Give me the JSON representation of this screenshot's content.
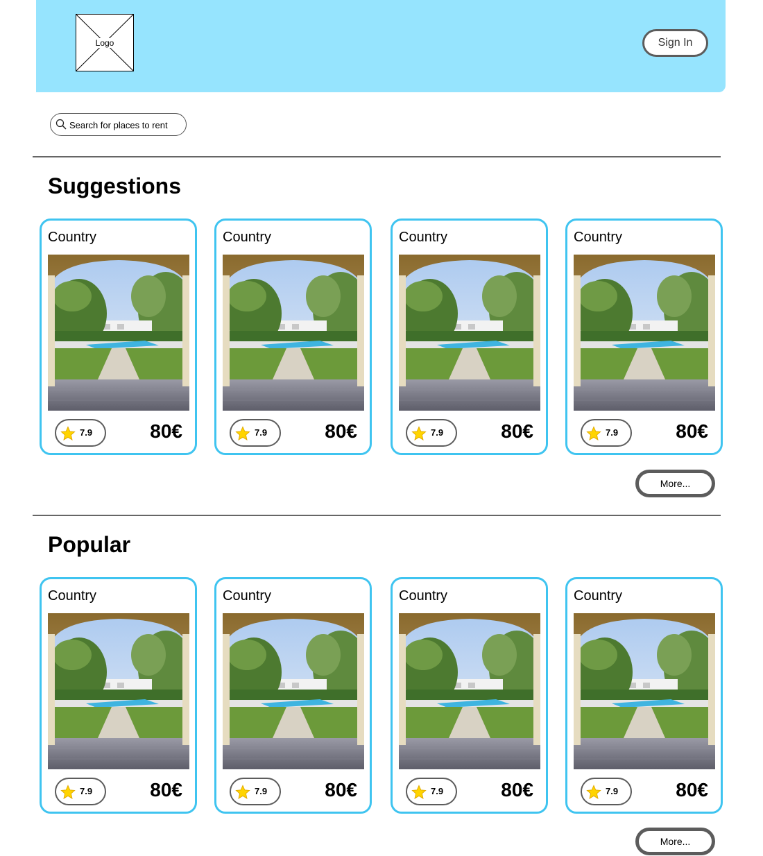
{
  "header": {
    "logo_label": "Logo",
    "signin_label": "Sign In",
    "background_color": "#96e4fe"
  },
  "search": {
    "placeholder": "Search for places to rent",
    "value": "",
    "icon": "search-icon"
  },
  "sections": [
    {
      "title": "Suggestions",
      "more_label": "More...",
      "cards": [
        {
          "country": "Country",
          "rating": "7.9",
          "price": "80€"
        },
        {
          "country": "Country",
          "rating": "7.9",
          "price": "80€"
        },
        {
          "country": "Country",
          "rating": "7.9",
          "price": "80€"
        },
        {
          "country": "Country",
          "rating": "7.9",
          "price": "80€"
        }
      ]
    },
    {
      "title": "Popular",
      "more_label": "More...",
      "cards": [
        {
          "country": "Country",
          "rating": "7.9",
          "price": "80€"
        },
        {
          "country": "Country",
          "rating": "7.9",
          "price": "80€"
        },
        {
          "country": "Country",
          "rating": "7.9",
          "price": "80€"
        },
        {
          "country": "Country",
          "rating": "7.9",
          "price": "80€"
        }
      ]
    }
  ],
  "colors": {
    "card_border": "#3fc4f0",
    "button_border": "#5c5c5c",
    "star": "#ffd400"
  }
}
